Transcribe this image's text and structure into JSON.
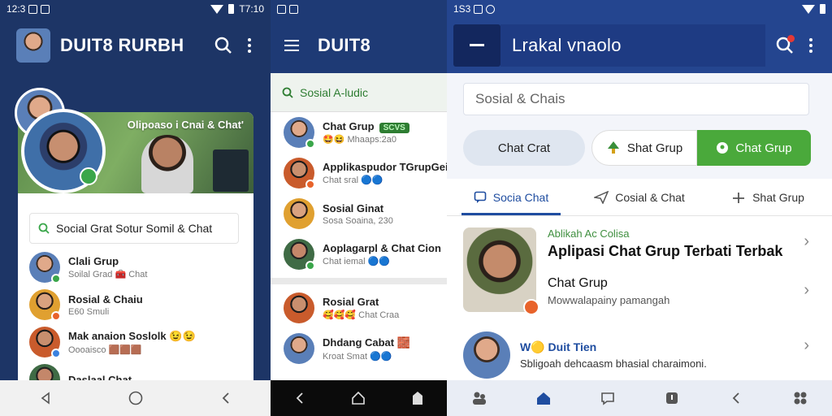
{
  "colors": {
    "brand_navy": "#1e3a75",
    "accent_green": "#4aa93b",
    "tab_blue": "#1f4da0"
  },
  "panel1": {
    "status": {
      "time": "12:3",
      "right": "T7:10"
    },
    "app_title": "DUIT8 RURBH",
    "hero_caption": "Olipoaso i Cnai & Chat'",
    "search_text": "Social Grat Sotur Somil & Chat",
    "rows": [
      {
        "name": "Clali Grup",
        "sub": "Soilal Grad 🧰 Chat"
      },
      {
        "name": "Rosial & Chaiu",
        "sub": "E60 Smuli"
      },
      {
        "name": "Mak anaion Soslolk 😉😉",
        "sub": "Oooaisco 🟫🟫🟫"
      },
      {
        "name": "Daslaal Chat",
        "sub": ""
      }
    ]
  },
  "panel2": {
    "app_title": "DUIT8",
    "search_text": "Sosial A-ludic",
    "rows": [
      {
        "name": "Chat Grup",
        "sub": "🤩😆 Mhaaps:2a0",
        "pill": "SCVS"
      },
      {
        "name": "Applikaspudor TGrupGei",
        "sub": "Chat sral 🔵🔵"
      },
      {
        "name": "Sosial Ginat",
        "sub": "Sosa Soaina, 230"
      },
      {
        "name": "Aoplagarpl & Chat Cion",
        "sub": "Chat iemal 🔵🔵"
      },
      {
        "name": "Rosial Grat",
        "sub": "🥰🥰🥰 Chat Craa"
      },
      {
        "name": "Dhdang Cabat 🧱",
        "sub": "Kroat Smat 🔵🔵"
      }
    ]
  },
  "panel3": {
    "status": {
      "time": "1S3"
    },
    "app_title": "Lrakal vnaolo",
    "search_placeholder": "Sosial & Chais",
    "chips": [
      "Chat Crat",
      "Shat Grup",
      "Chat Grup"
    ],
    "tabs": [
      "Socia Chat",
      "Cosial & Chat",
      "Shat Grup"
    ],
    "item1": {
      "kicker": "Ablikah Ac Colisa",
      "headline": "Aplipasi Chat Grup Terbati Terbak",
      "sub_title": "Chat Grup",
      "sub_text": "Mowwalapainy pamangah"
    },
    "item2": {
      "tag": "W🟡",
      "title": "Duit Tien",
      "text": "Sbligoah dehcaasm bhasial charaimoni."
    }
  }
}
